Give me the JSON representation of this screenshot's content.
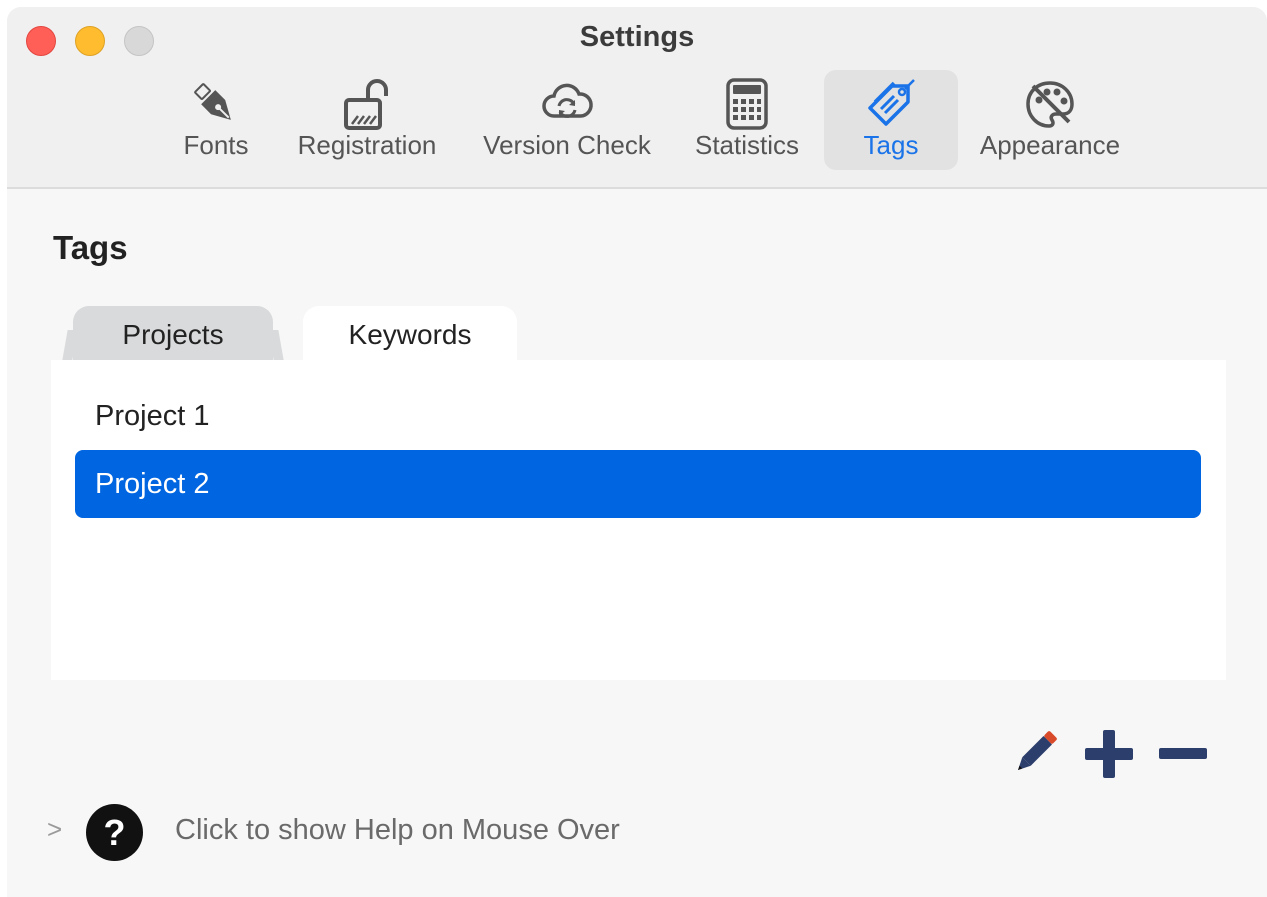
{
  "window": {
    "title": "Settings"
  },
  "toolbar": {
    "items": [
      {
        "label": "Fonts",
        "icon": "fountain-pen-icon"
      },
      {
        "label": "Registration",
        "icon": "unlocked-padlock-icon"
      },
      {
        "label": "Version Check",
        "icon": "cloud-sync-icon"
      },
      {
        "label": "Statistics",
        "icon": "calculator-icon"
      },
      {
        "label": "Tags",
        "icon": "tags-icon",
        "active": true
      },
      {
        "label": "Appearance",
        "icon": "palette-icon"
      }
    ],
    "active_color": "#1a73e8"
  },
  "section": {
    "title": "Tags"
  },
  "tabs": [
    {
      "label": "Projects",
      "selected": true
    },
    {
      "label": "Keywords",
      "selected": false
    }
  ],
  "list": {
    "items": [
      {
        "label": "Project 1",
        "selected": false
      },
      {
        "label": "Project 2",
        "selected": true
      }
    ],
    "selection_color": "#0065e0"
  },
  "actions": {
    "edit_icon": "pencil-icon",
    "add_icon": "plus-icon",
    "remove_icon": "minus-icon",
    "icon_color": "#2c3e6b"
  },
  "help": {
    "chevron": ">",
    "icon_glyph": "?",
    "text": "Click to show Help on Mouse Over"
  }
}
